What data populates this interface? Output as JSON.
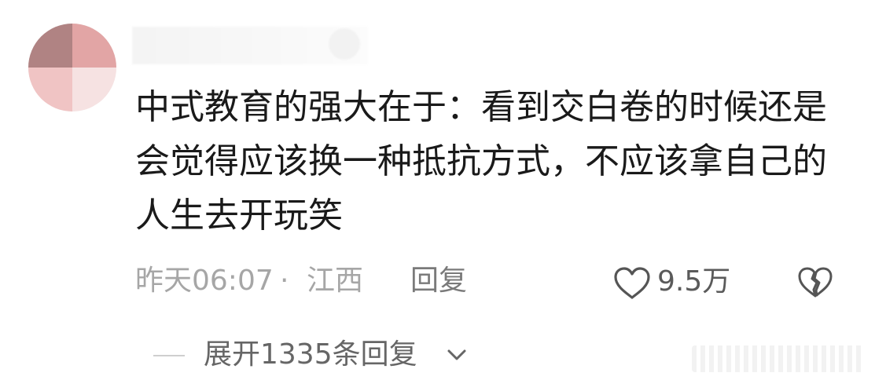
{
  "comment": {
    "text": "中式教育的强大在于：看到交白卷的时候还是会觉得应该换一种抵抗方式，不应该拿自己的人生去开玩笑",
    "time": "昨天06:07",
    "separator": "·",
    "location": "江西",
    "reply_label": "回复",
    "like_count": "9.5万"
  },
  "replies": {
    "expand_label": "展开1335条回复"
  },
  "icons": {
    "like": "heart-outline-icon",
    "dislike": "broken-heart-icon",
    "expand": "chevron-down-icon"
  },
  "colors": {
    "text_primary": "#1a1a1a",
    "text_meta": "#a6a6a6",
    "text_secondary": "#666666"
  }
}
